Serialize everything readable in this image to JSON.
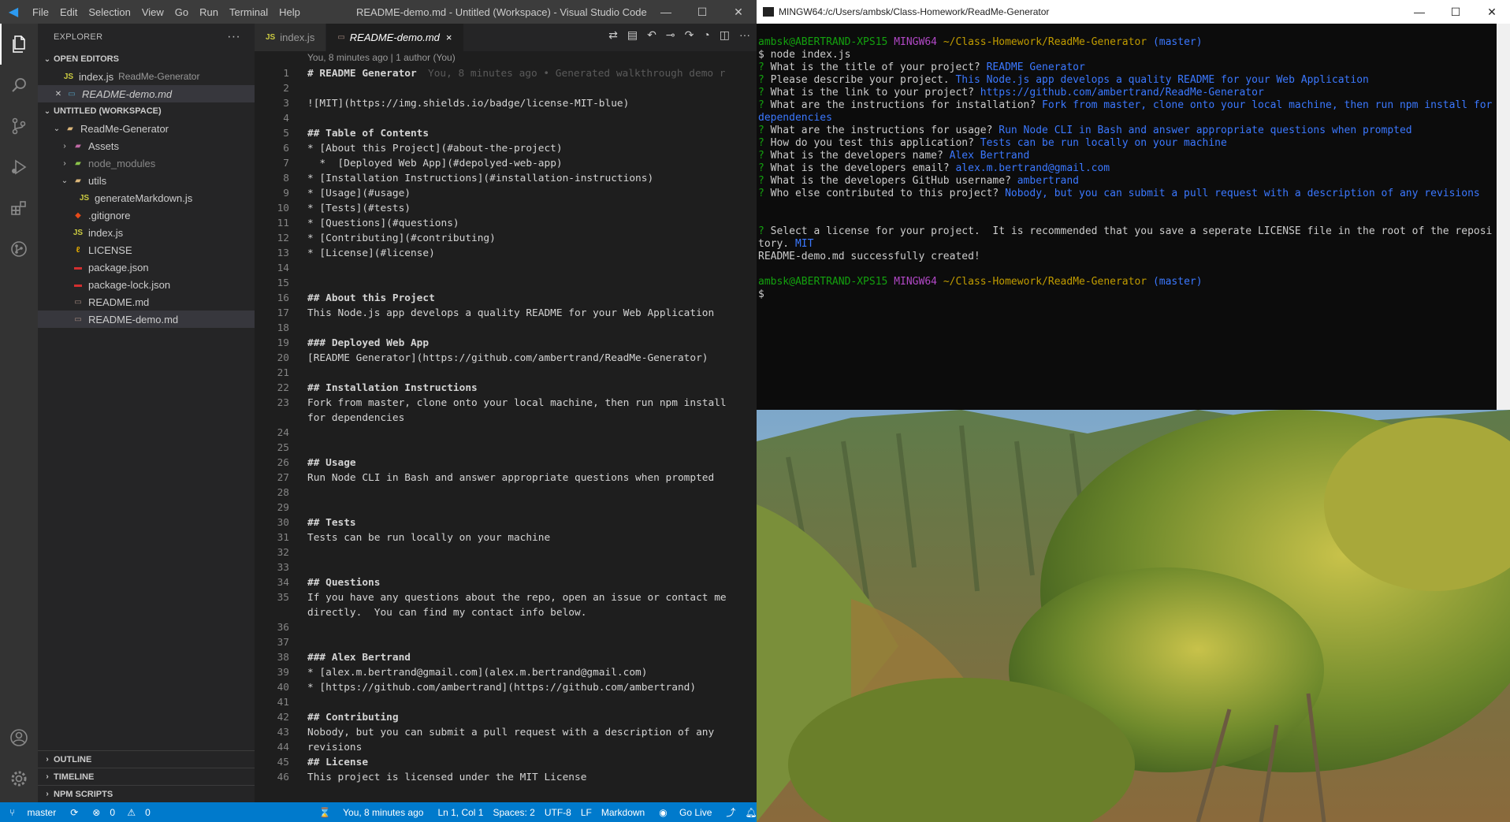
{
  "vscode": {
    "menu": [
      "File",
      "Edit",
      "Selection",
      "View",
      "Go",
      "Run",
      "Terminal",
      "Help"
    ],
    "window_title": "README-demo.md - Untitled (Workspace) - Visual Studio Code",
    "explorer": {
      "title": "EXPLORER",
      "open_editors_label": "OPEN EDITORS",
      "open_editors": [
        {
          "icon": "JS",
          "name": "index.js",
          "sub": "ReadMe-Generator"
        },
        {
          "icon": "md",
          "name": "README-demo.md",
          "sub": ""
        }
      ],
      "workspace_label": "UNTITLED (WORKSPACE)",
      "root_folder": "ReadMe-Generator",
      "tree": [
        {
          "name": "Assets",
          "kind": "folder"
        },
        {
          "name": "node_modules",
          "kind": "folder"
        },
        {
          "name": "utils",
          "kind": "folder-open"
        },
        {
          "name": "generateMarkdown.js",
          "kind": "js"
        },
        {
          "name": ".gitignore",
          "kind": "git"
        },
        {
          "name": "index.js",
          "kind": "js"
        },
        {
          "name": "LICENSE",
          "kind": "license"
        },
        {
          "name": "package.json",
          "kind": "json"
        },
        {
          "name": "package-lock.json",
          "kind": "json"
        },
        {
          "name": "README.md",
          "kind": "md"
        },
        {
          "name": "README-demo.md",
          "kind": "md"
        }
      ],
      "bottom_sections": [
        "OUTLINE",
        "TIMELINE",
        "NPM SCRIPTS"
      ]
    },
    "tabs": [
      {
        "icon": "JS",
        "name": "index.js"
      },
      {
        "icon": "md",
        "name": "README-demo.md",
        "close": "×"
      }
    ],
    "codelens": "You, 8 minutes ago | 1 author (You)",
    "blame": "You, 8 minutes ago • Generated walkthrough demo r",
    "lines": [
      "# README Generator",
      "",
      "![MIT](https://img.shields.io/badge/license-MIT-blue)",
      "",
      "## Table of Contents",
      "* [About this Project](#about-the-project)",
      "  *  [Deployed Web App](#depolyed-web-app)",
      "* [Installation Instructions](#installation-instructions)",
      "* [Usage](#usage)",
      "* [Tests](#tests)",
      "* [Questions](#questions)",
      "* [Contributing](#contributing)",
      "* [License](#license)",
      "",
      "",
      "## About this Project",
      "This Node.js app develops a quality README for your Web Application",
      "",
      "### Deployed Web App",
      "[README Generator](https://github.com/ambertrand/ReadMe-Generator)",
      "",
      "## Installation Instructions",
      "Fork from master, clone onto your local machine, then run npm install for dependencies",
      "",
      "",
      "## Usage",
      "Run Node CLI in Bash and answer appropriate questions when prompted",
      "",
      "",
      "## Tests",
      "Tests can be run locally on your machine",
      "",
      "",
      "## Questions",
      "If you have any questions about the repo, open an issue or contact me directly.  You can find my contact info below.",
      "",
      "",
      "### Alex Bertrand",
      "* [alex.m.bertrand@gmail.com](alex.m.bertrand@gmail.com)",
      "* [https://github.com/ambertrand](https://github.com/ambertrand)",
      "",
      "## Contributing",
      "Nobody, but you can submit a pull request with a description of any revisions",
      "",
      "## License",
      "This project is licensed under the MIT License"
    ],
    "status": {
      "branch": "master",
      "errors": "0",
      "warnings": "0",
      "blame": "You, 8 minutes ago",
      "position": "Ln 1, Col 1",
      "spaces": "Spaces: 2",
      "encoding": "UTF-8",
      "eol": "LF",
      "language": "Markdown",
      "golive": "Go Live"
    }
  },
  "terminal": {
    "title": "MINGW64:/c/Users/ambsk/Class-Homework/ReadMe-Generator",
    "prompt_user": "ambsk@ABERTRAND-XPS15",
    "prompt_env": "MINGW64",
    "prompt_path": "~/Class-Homework/ReadMe-Generator",
    "prompt_branch": "(master)",
    "command": "$ node index.js",
    "qa": [
      {
        "q": "What is the title of your project?",
        "a": "README Generator"
      },
      {
        "q": "Please describe your project.",
        "a": "This Node.js app develops a quality README for your Web Application"
      },
      {
        "q": "What is the link to your project?",
        "a": "https://github.com/ambertrand/ReadMe-Generator"
      },
      {
        "q": "What are the instructions for installation?",
        "a": "Fork from master, clone onto your local machine, then run npm install for dependencies"
      },
      {
        "q": "What are the instructions for usage?",
        "a": "Run Node CLI in Bash and answer appropriate questions when prompted"
      },
      {
        "q": "How do you test this application?",
        "a": "Tests can be run locally on your machine"
      },
      {
        "q": "What is the developers name?",
        "a": "Alex Bertrand"
      },
      {
        "q": "What is the developers email?",
        "a": "alex.m.bertrand@gmail.com"
      },
      {
        "q": "What is the developers GitHub username?",
        "a": "ambertrand"
      },
      {
        "q": "Who else contributed to this project?",
        "a": "Nobody, but you can submit a pull request with a description of any revisions"
      }
    ],
    "license_q": "Select a license for your project.  It is recommended that you save a seperate LICENSE file in the root of the repository.",
    "license_a": "MIT",
    "success": "README-demo.md successfully created!",
    "cursor": "$"
  },
  "colors": {
    "accent": "#007acc",
    "heading": "#569cd6",
    "link": "#ce9178",
    "terminal_green": "#13a10e",
    "terminal_purple": "#b148c6",
    "terminal_yellow": "#c19c00",
    "terminal_blue": "#3b78ff"
  }
}
